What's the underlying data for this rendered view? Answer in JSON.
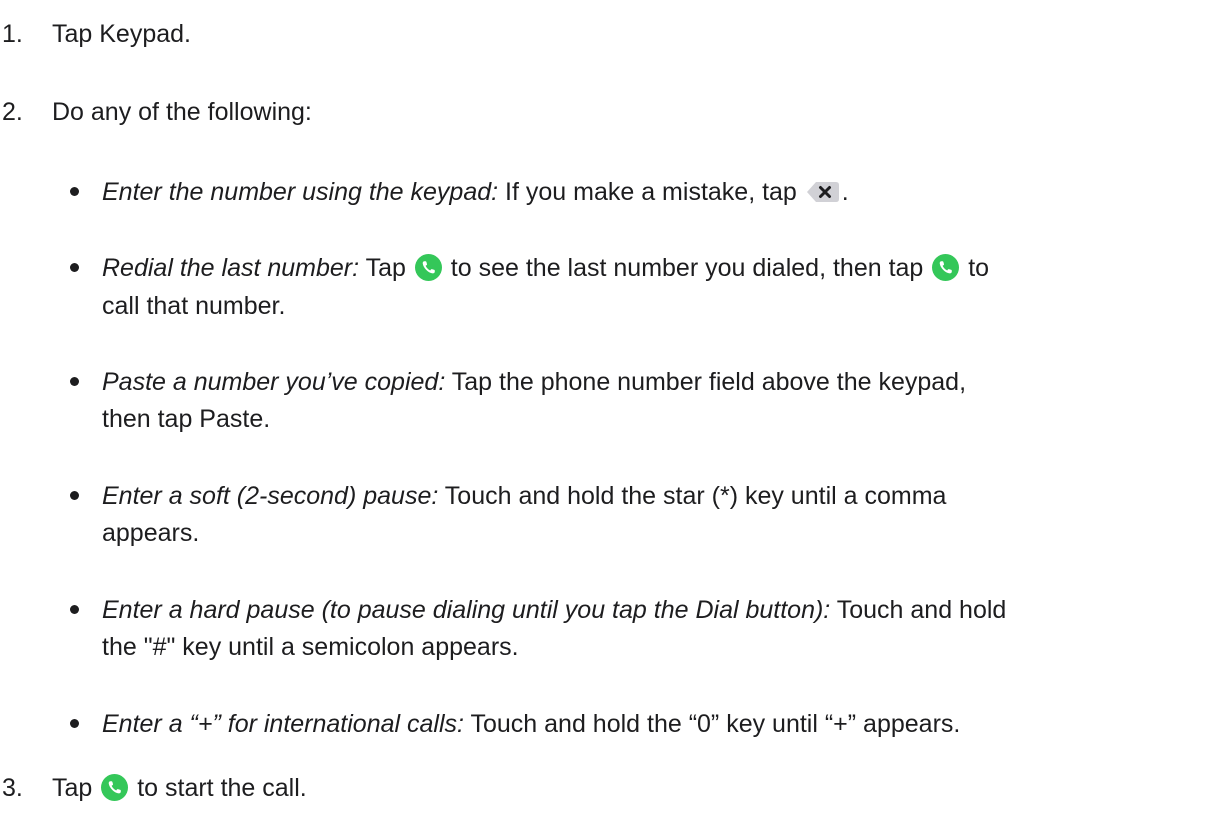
{
  "steps": [
    {
      "num": "1.",
      "text": "Tap Keypad."
    },
    {
      "num": "2.",
      "text": "Do any of the following:"
    },
    {
      "num": "3.",
      "text_before": "Tap ",
      "icon": "phone-call-icon",
      "text_after": " to start the call."
    }
  ],
  "bullets": {
    "enter_number": {
      "label": "Enter the number using the keypad:",
      "text": " If you make a mistake, tap ",
      "icon": "delete-backspace-icon",
      "text_end": "."
    },
    "redial": {
      "label": "Redial the last number:",
      "text1": " Tap ",
      "icon1": "phone-call-icon",
      "text2": " to see the last number you dialed, then tap ",
      "icon2": "phone-call-icon",
      "text3": " to",
      "line2": "call that number."
    },
    "paste": {
      "label": "Paste a number you’ve copied:",
      "text": " Tap the phone number field above the keypad,",
      "line2": "then tap Paste."
    },
    "soft_pause": {
      "label": "Enter a soft (2-second) pause:",
      "text": " Touch and hold the star (*) key until a comma",
      "line2": "appears."
    },
    "hard_pause": {
      "label": "Enter a hard pause (to pause dialing until you tap the Dial button):",
      "text": " Touch and hold",
      "line2": "the \"#\" key until a semicolon appears."
    },
    "plus": {
      "label": "Enter a “+” for international calls:",
      "text": " Touch and hold the “0” key until “+” appears."
    }
  },
  "colors": {
    "text": "#1d1d1f",
    "call_green": "#34c759",
    "delete_gray": "#d1d1d6"
  }
}
